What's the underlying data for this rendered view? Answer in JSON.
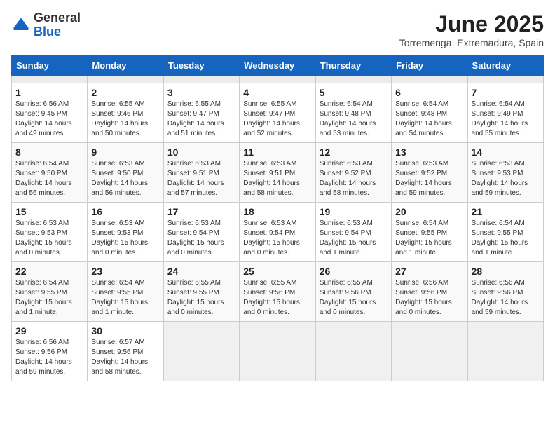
{
  "header": {
    "logo_general": "General",
    "logo_blue": "Blue",
    "month_year": "June 2025",
    "location": "Torremenga, Extremadura, Spain"
  },
  "calendar": {
    "days_of_week": [
      "Sunday",
      "Monday",
      "Tuesday",
      "Wednesday",
      "Thursday",
      "Friday",
      "Saturday"
    ],
    "weeks": [
      [
        {
          "day": "",
          "empty": true
        },
        {
          "day": "",
          "empty": true
        },
        {
          "day": "",
          "empty": true
        },
        {
          "day": "",
          "empty": true
        },
        {
          "day": "",
          "empty": true
        },
        {
          "day": "",
          "empty": true
        },
        {
          "day": "",
          "empty": true
        }
      ],
      [
        {
          "day": "1",
          "sunrise": "6:56 AM",
          "sunset": "9:45 PM",
          "daylight": "14 hours and 49 minutes."
        },
        {
          "day": "2",
          "sunrise": "6:55 AM",
          "sunset": "9:46 PM",
          "daylight": "14 hours and 50 minutes."
        },
        {
          "day": "3",
          "sunrise": "6:55 AM",
          "sunset": "9:47 PM",
          "daylight": "14 hours and 51 minutes."
        },
        {
          "day": "4",
          "sunrise": "6:55 AM",
          "sunset": "9:47 PM",
          "daylight": "14 hours and 52 minutes."
        },
        {
          "day": "5",
          "sunrise": "6:54 AM",
          "sunset": "9:48 PM",
          "daylight": "14 hours and 53 minutes."
        },
        {
          "day": "6",
          "sunrise": "6:54 AM",
          "sunset": "9:48 PM",
          "daylight": "14 hours and 54 minutes."
        },
        {
          "day": "7",
          "sunrise": "6:54 AM",
          "sunset": "9:49 PM",
          "daylight": "14 hours and 55 minutes."
        }
      ],
      [
        {
          "day": "8",
          "sunrise": "6:54 AM",
          "sunset": "9:50 PM",
          "daylight": "14 hours and 56 minutes."
        },
        {
          "day": "9",
          "sunrise": "6:53 AM",
          "sunset": "9:50 PM",
          "daylight": "14 hours and 56 minutes."
        },
        {
          "day": "10",
          "sunrise": "6:53 AM",
          "sunset": "9:51 PM",
          "daylight": "14 hours and 57 minutes."
        },
        {
          "day": "11",
          "sunrise": "6:53 AM",
          "sunset": "9:51 PM",
          "daylight": "14 hours and 58 minutes."
        },
        {
          "day": "12",
          "sunrise": "6:53 AM",
          "sunset": "9:52 PM",
          "daylight": "14 hours and 58 minutes."
        },
        {
          "day": "13",
          "sunrise": "6:53 AM",
          "sunset": "9:52 PM",
          "daylight": "14 hours and 59 minutes."
        },
        {
          "day": "14",
          "sunrise": "6:53 AM",
          "sunset": "9:53 PM",
          "daylight": "14 hours and 59 minutes."
        }
      ],
      [
        {
          "day": "15",
          "sunrise": "6:53 AM",
          "sunset": "9:53 PM",
          "daylight": "15 hours and 0 minutes."
        },
        {
          "day": "16",
          "sunrise": "6:53 AM",
          "sunset": "9:53 PM",
          "daylight": "15 hours and 0 minutes."
        },
        {
          "day": "17",
          "sunrise": "6:53 AM",
          "sunset": "9:54 PM",
          "daylight": "15 hours and 0 minutes."
        },
        {
          "day": "18",
          "sunrise": "6:53 AM",
          "sunset": "9:54 PM",
          "daylight": "15 hours and 0 minutes."
        },
        {
          "day": "19",
          "sunrise": "6:53 AM",
          "sunset": "9:54 PM",
          "daylight": "15 hours and 1 minute."
        },
        {
          "day": "20",
          "sunrise": "6:54 AM",
          "sunset": "9:55 PM",
          "daylight": "15 hours and 1 minute."
        },
        {
          "day": "21",
          "sunrise": "6:54 AM",
          "sunset": "9:55 PM",
          "daylight": "15 hours and 1 minute."
        }
      ],
      [
        {
          "day": "22",
          "sunrise": "6:54 AM",
          "sunset": "9:55 PM",
          "daylight": "15 hours and 1 minute."
        },
        {
          "day": "23",
          "sunrise": "6:54 AM",
          "sunset": "9:55 PM",
          "daylight": "15 hours and 1 minute."
        },
        {
          "day": "24",
          "sunrise": "6:55 AM",
          "sunset": "9:55 PM",
          "daylight": "15 hours and 0 minutes."
        },
        {
          "day": "25",
          "sunrise": "6:55 AM",
          "sunset": "9:56 PM",
          "daylight": "15 hours and 0 minutes."
        },
        {
          "day": "26",
          "sunrise": "6:55 AM",
          "sunset": "9:56 PM",
          "daylight": "15 hours and 0 minutes."
        },
        {
          "day": "27",
          "sunrise": "6:56 AM",
          "sunset": "9:56 PM",
          "daylight": "15 hours and 0 minutes."
        },
        {
          "day": "28",
          "sunrise": "6:56 AM",
          "sunset": "9:56 PM",
          "daylight": "14 hours and 59 minutes."
        }
      ],
      [
        {
          "day": "29",
          "sunrise": "6:56 AM",
          "sunset": "9:56 PM",
          "daylight": "14 hours and 59 minutes."
        },
        {
          "day": "30",
          "sunrise": "6:57 AM",
          "sunset": "9:56 PM",
          "daylight": "14 hours and 58 minutes."
        },
        {
          "day": "",
          "empty": true
        },
        {
          "day": "",
          "empty": true
        },
        {
          "day": "",
          "empty": true
        },
        {
          "day": "",
          "empty": true
        },
        {
          "day": "",
          "empty": true
        }
      ]
    ]
  }
}
